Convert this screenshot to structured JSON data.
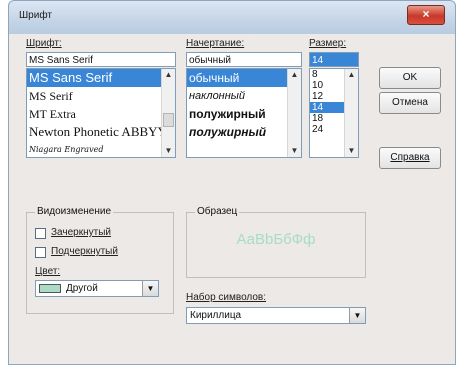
{
  "window": {
    "title": "Шрифт",
    "close_glyph": "×"
  },
  "font": {
    "label": "Шрифт:",
    "value": "MS Sans Serif",
    "items": [
      "MS Sans Serif",
      "MS Serif",
      "MT Extra",
      "Newton Phonetic ABBYY",
      "Niagara Engraved"
    ],
    "selected_index": 0
  },
  "style": {
    "label": "Начертание:",
    "value": "обычный",
    "items": [
      "обычный",
      "наклонный",
      "полужирный",
      "полужирный"
    ],
    "selected_index": 0
  },
  "size": {
    "label": "Размер:",
    "value": "14",
    "items": [
      "8",
      "10",
      "12",
      "14",
      "18",
      "24"
    ],
    "selected_index": 3
  },
  "buttons": {
    "ok": "OK",
    "cancel": "Отмена",
    "help": "Справка"
  },
  "effects": {
    "title": "Видоизменение",
    "strikeout": "Зачеркнутый",
    "underline": "Подчеркнутый",
    "color_label": "Цвет:",
    "color_value": "Другой",
    "color_swatch": "#a8dcc6"
  },
  "sample": {
    "title": "Образец",
    "text": "АаВbБбФф",
    "text_color": "#a8dcc6"
  },
  "charset": {
    "label": "Набор символов:",
    "value": "Кириллица"
  },
  "accent": "#3a86d6"
}
